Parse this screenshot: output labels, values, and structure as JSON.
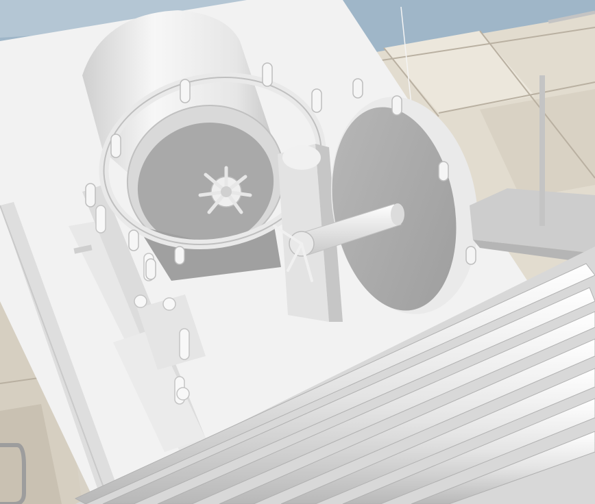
{
  "viewport": {
    "kind": "3d-simulation-render",
    "scene_objects": [
      "sky-backdrop",
      "floor-tiles",
      "base-platform",
      "cylindrical-drum",
      "spoked-ring",
      "central-gear",
      "support-plate",
      "flywheel-disc",
      "axle-shaft",
      "guide-rail",
      "rod-bundle",
      "diagonal-panel",
      "vertical-pole"
    ]
  },
  "colors": {
    "sky": "#9fb6c8",
    "floor_light": "#e4ded2",
    "floor_dark": "#cfc7b8",
    "grout": "#b9b0a1",
    "model_white": "#f4f4f4",
    "model_shade": "#d2d2d2",
    "model_dark": "#a8a8a8"
  }
}
